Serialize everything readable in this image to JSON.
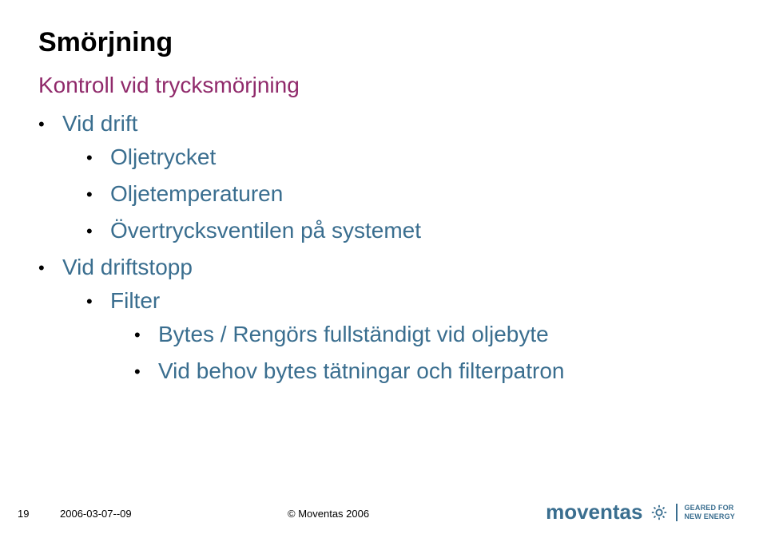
{
  "title": "Smörjning",
  "subtitle": "Kontroll vid trycksmörjning",
  "bullets": {
    "b1": "Vid drift",
    "b1_sub": {
      "s1": "Oljetrycket",
      "s2": "Oljetemperaturen",
      "s3": "Övertrycksventilen på systemet"
    },
    "b2": "Vid driftstopp",
    "b2_sub": {
      "s1": "Filter",
      "s1_sub": {
        "ss1": "Bytes / Rengörs fullständigt vid oljebyte",
        "ss2": "Vid behov bytes tätningar och filterpatron"
      }
    }
  },
  "footer": {
    "page": "19",
    "date": "2006-03-07--09",
    "copyright": "© Moventas 2006"
  },
  "logo": {
    "word": "moventas",
    "tag1": "GEARED FOR",
    "tag2": "NEW ENERGY"
  }
}
